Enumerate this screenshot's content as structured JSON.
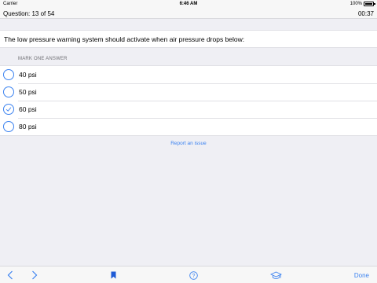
{
  "status": {
    "carrier": "Carrier",
    "time": "6:46 AM",
    "battery": "100%"
  },
  "nav": {
    "question_label": "Question: 13 of 54",
    "timer": "00:37"
  },
  "question": {
    "text": "The low pressure warning system should activate when air pressure drops below:",
    "instruction": "MARK ONE ANSWER"
  },
  "answers": [
    {
      "label": "40 psi",
      "selected": false
    },
    {
      "label": "50 psi",
      "selected": false
    },
    {
      "label": "60 psi",
      "selected": true
    },
    {
      "label": "80 psi",
      "selected": false
    }
  ],
  "report_link": "Report an issue",
  "toolbar": {
    "done_label": "Done",
    "icons": [
      "chevron-left-icon",
      "chevron-right-icon",
      "bookmark-icon",
      "help-icon",
      "graduation-cap-icon"
    ]
  },
  "colors": {
    "accent": "#3b82f0",
    "background": "#efeff4",
    "bookmark": "#1f5bd6"
  }
}
